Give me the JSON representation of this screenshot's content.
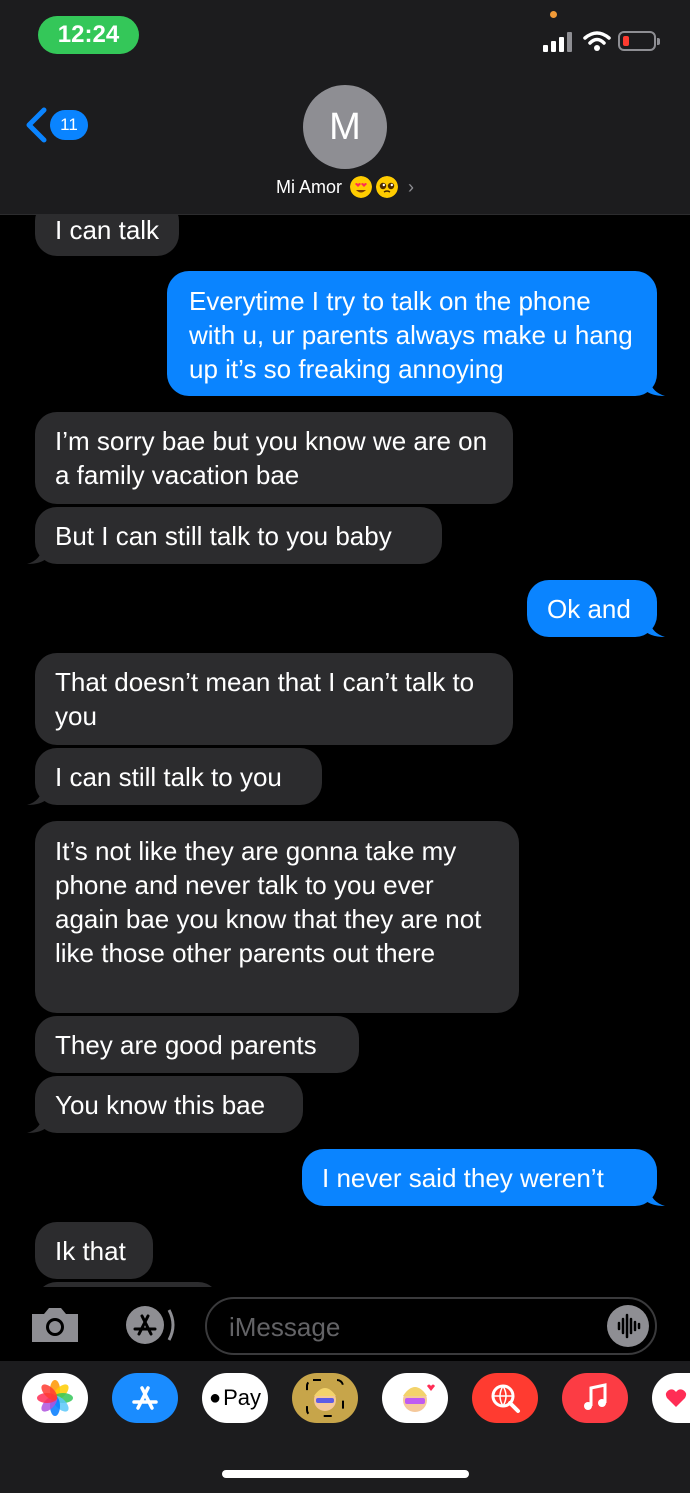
{
  "status_bar": {
    "time": "12:24",
    "battery_color": "#ff3b30"
  },
  "header": {
    "back_count": "11",
    "avatar_initial": "M",
    "contact_name": "Mi Amor",
    "emoji_icons": [
      "heart-eyes-emoji",
      "pleading-face-emoji"
    ]
  },
  "messages": [
    {
      "dir": "recv",
      "text": "I can talk"
    },
    {
      "dir": "sent",
      "text": "Everytime I try to talk on the phone with u, ur parents always make u hang up it’s so freaking annoying"
    },
    {
      "dir": "recv",
      "text": "I’m sorry bae but you know we are on a family vacation bae"
    },
    {
      "dir": "recv",
      "text": "But I can still talk to you baby"
    },
    {
      "dir": "sent",
      "text": "Ok and"
    },
    {
      "dir": "recv",
      "text": "That doesn’t mean that I can’t talk to you"
    },
    {
      "dir": "recv",
      "text": "I can still talk to you"
    },
    {
      "dir": "recv",
      "text": "It’s not like they are gonna take my phone and never talk to you ever again bae you know that they are not like those other parents out there"
    },
    {
      "dir": "recv",
      "text": "They are good parents"
    },
    {
      "dir": "recv",
      "text": "You know this bae"
    },
    {
      "dir": "sent",
      "text": "I never said they weren’t"
    },
    {
      "dir": "recv",
      "text": "Ik that"
    }
  ],
  "compose": {
    "placeholder": "iMessage"
  },
  "app_tray": {
    "items": [
      "photos-icon",
      "app-store-icon",
      "apple-pay-icon",
      "memoji-icon",
      "memoji-stickers-icon",
      "web-search-icon",
      "music-icon",
      "heart-stickers-icon"
    ],
    "apple_pay_label": "Pay"
  },
  "colors": {
    "sent_bubble": "#0a84ff",
    "recv_bubble": "#2c2c2e",
    "background": "#000000"
  }
}
